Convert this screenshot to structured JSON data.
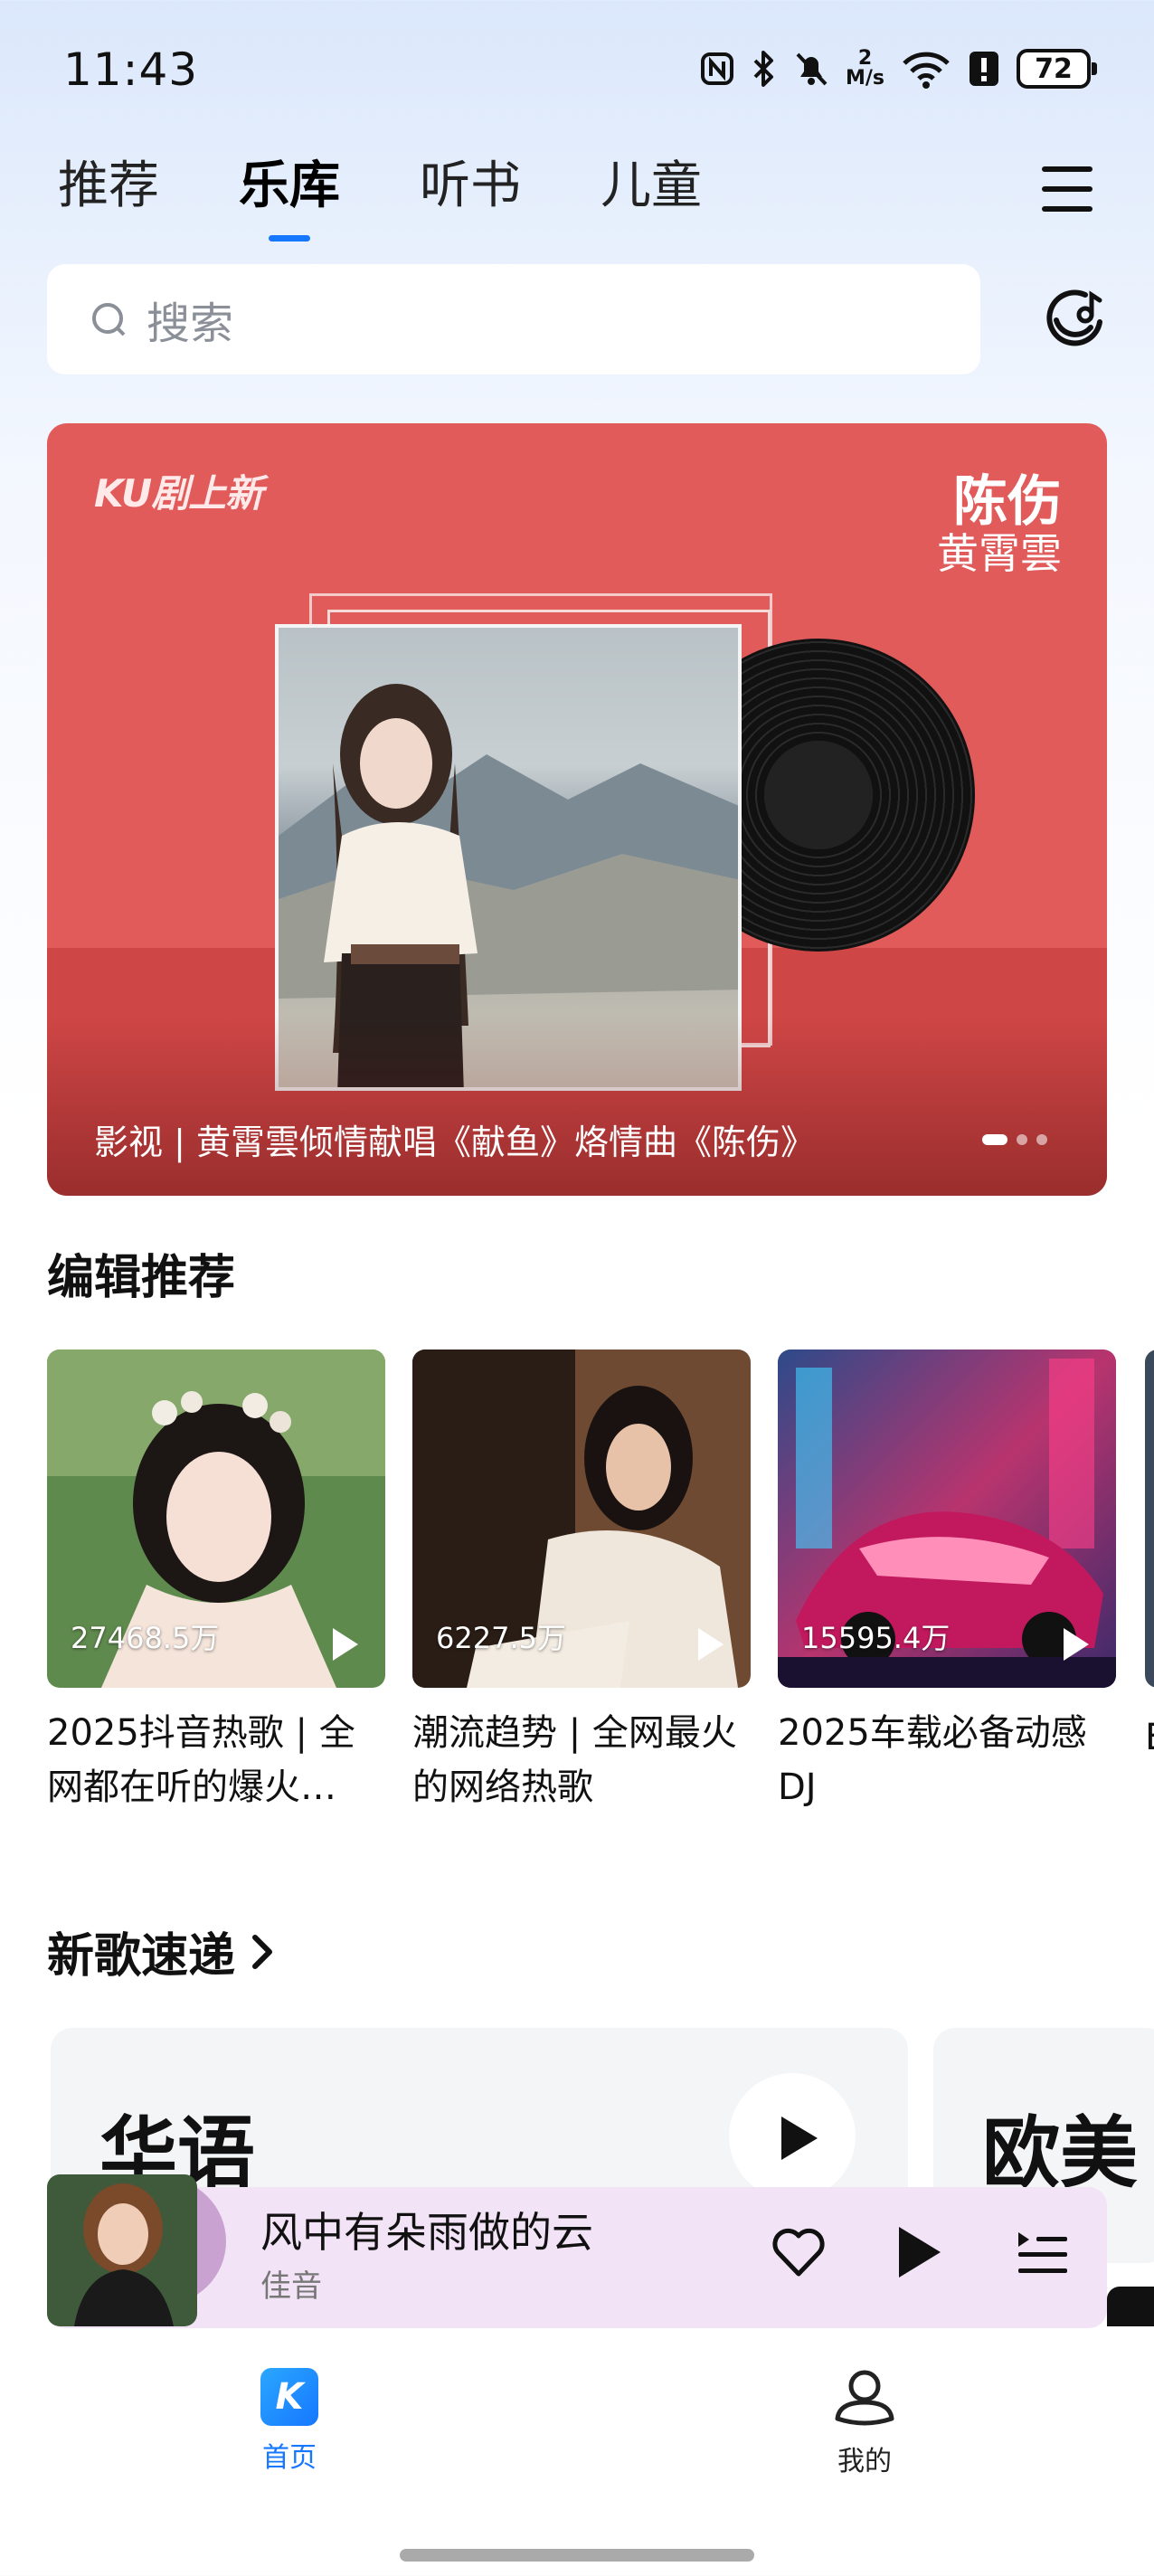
{
  "status": {
    "time": "11:43",
    "speed_value": "2",
    "speed_unit": "M/s",
    "battery": "72"
  },
  "tabs": [
    {
      "label": "推荐",
      "active": false
    },
    {
      "label": "乐库",
      "active": true
    },
    {
      "label": "听书",
      "active": false
    },
    {
      "label": "儿童",
      "active": false
    }
  ],
  "search": {
    "placeholder": "搜索"
  },
  "banner": {
    "logo": "KU剧上新",
    "song": "陈伤",
    "artist": "黄霄雲",
    "caption": "影视 | 黄霄雲倾情献唱《献鱼》烙情曲《陈伤》",
    "slide_count": 3,
    "active_slide": 1
  },
  "editor_section": {
    "title": "编辑推荐",
    "playlists": [
      {
        "count": "27468.5万",
        "title": "2025抖音热歌 | 全网都在听的爆火…"
      },
      {
        "count": "6227.5万",
        "title": "潮流趋势 | 全网最火的网络热歌"
      },
      {
        "count": "15595.4万",
        "title": "2025车载必备动感DJ"
      }
    ],
    "peek_text": "E"
  },
  "new_songs": {
    "title": "新歌速递",
    "cards": [
      {
        "label": "华语"
      },
      {
        "label": "欧美"
      }
    ]
  },
  "player": {
    "title": "风中有朵雨做的云",
    "artist": "佳音"
  },
  "bottom_nav": {
    "home": {
      "label": "首页",
      "logo": "K"
    },
    "mine": {
      "label": "我的"
    }
  },
  "colors": {
    "accent": "#1677ff",
    "banner_bg": "#e15b5b",
    "player_bg": "#f3e3f6"
  }
}
